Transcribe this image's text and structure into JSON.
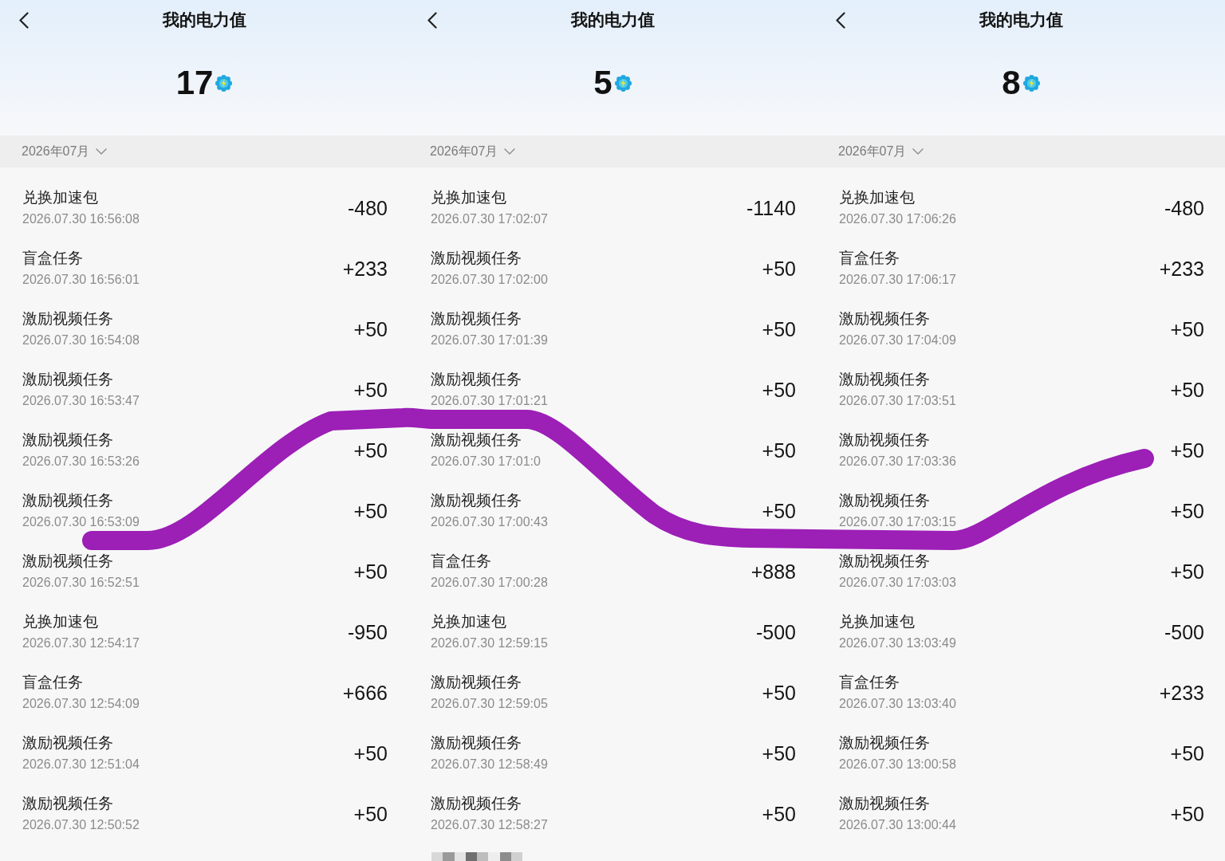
{
  "screenshots": [
    {
      "title": "我的电力值",
      "balance": "17",
      "month": "2026年07月",
      "records": [
        {
          "kind": "entry",
          "title": "兑换加速包",
          "time": "2026.07.30 16:56:08",
          "amount": "-480"
        },
        {
          "kind": "entry",
          "title": "盲盒任务",
          "time": "2026.07.30 16:56:01",
          "amount": "+233"
        },
        {
          "kind": "entry",
          "title": "激励视频任务",
          "time": "2026.07.30 16:54:08",
          "amount": "+50"
        },
        {
          "kind": "entry",
          "title": "激励视频任务",
          "time": "2026.07.30 16:53:47",
          "amount": "+50"
        },
        {
          "kind": "entry",
          "title": "激励视频任务",
          "time": "2026.07.30 16:53:26",
          "amount": "+50"
        },
        {
          "kind": "entry",
          "title": "激励视频任务",
          "time": "2026.07.30 16:53:09",
          "amount": "+50"
        },
        {
          "kind": "entry",
          "title": "激励视频任务",
          "time": "2026.07.30 16:52:51",
          "amount": "+50"
        },
        {
          "kind": "entry",
          "title": "兑换加速包",
          "time": "2026.07.30 12:54:17",
          "amount": "-950"
        },
        {
          "kind": "entry",
          "title": "盲盒任务",
          "time": "2026.07.30 12:54:09",
          "amount": "+666"
        },
        {
          "kind": "entry",
          "title": "激励视频任务",
          "time": "2026.07.30 12:51:04",
          "amount": "+50"
        },
        {
          "kind": "entry",
          "title": "激励视频任务",
          "time": "2026.07.30 12:50:52",
          "amount": "+50"
        }
      ]
    },
    {
      "title": "我的电力值",
      "balance": "5",
      "month": "2026年07月",
      "records": [
        {
          "kind": "entry",
          "title": "兑换加速包",
          "time": "2026.07.30 17:02:07",
          "amount": "-1140"
        },
        {
          "kind": "entry",
          "title": "激励视频任务",
          "time": "2026.07.30 17:02:00",
          "amount": "+50"
        },
        {
          "kind": "entry",
          "title": "激励视频任务",
          "time": "2026.07.30 17:01:39",
          "amount": "+50"
        },
        {
          "kind": "entry",
          "title": "激励视频任务",
          "time": "2026.07.30 17:01:21",
          "amount": "+50"
        },
        {
          "kind": "entry",
          "title": "激励视频任务",
          "time": "2026.07.30 17:01:0",
          "amount": "+50"
        },
        {
          "kind": "entry",
          "title": "激励视频任务",
          "time": "2026.07.30 17:00:43",
          "amount": "+50"
        },
        {
          "kind": "entry",
          "title": "盲盒任务",
          "time": "2026.07.30 17:00:28",
          "amount": "+888"
        },
        {
          "kind": "entry",
          "title": "兑换加速包",
          "time": "2026.07.30 12:59:15",
          "amount": "-500"
        },
        {
          "kind": "entry",
          "title": "激励视频任务",
          "time": "2026.07.30 12:59:05",
          "amount": "+50"
        },
        {
          "kind": "entry",
          "title": "激励视频任务",
          "time": "2026.07.30 12:58:49",
          "amount": "+50"
        },
        {
          "kind": "entry",
          "title": "激励视频任务",
          "time": "2026.07.30 12:58:27",
          "amount": "+50"
        },
        {
          "kind": "pixelated"
        }
      ]
    },
    {
      "title": "我的电力值",
      "balance": "8",
      "month": "2026年07月",
      "records": [
        {
          "kind": "entry",
          "title": "兑换加速包",
          "time": "2026.07.30 17:06:26",
          "amount": "-480"
        },
        {
          "kind": "entry",
          "title": "盲盒任务",
          "time": "2026.07.30 17:06:17",
          "amount": "+233"
        },
        {
          "kind": "entry",
          "title": "激励视频任务",
          "time": "2026.07.30 17:04:09",
          "amount": "+50"
        },
        {
          "kind": "entry",
          "title": "激励视频任务",
          "time": "2026.07.30 17:03:51",
          "amount": "+50"
        },
        {
          "kind": "entry",
          "title": "激励视频任务",
          "time": "2026.07.30 17:03:36",
          "amount": "+50"
        },
        {
          "kind": "entry",
          "title": "激励视频任务",
          "time": "2026.07.30 17:03:15",
          "amount": "+50"
        },
        {
          "kind": "entry",
          "title": "激励视频任务",
          "time": "2026.07.30 17:03:03",
          "amount": "+50"
        },
        {
          "kind": "entry",
          "title": "兑换加速包",
          "time": "2026.07.30 13:03:49",
          "amount": "-500"
        },
        {
          "kind": "entry",
          "title": "盲盒任务",
          "time": "2026.07.30 13:03:40",
          "amount": "+233"
        },
        {
          "kind": "entry",
          "title": "激励视频任务",
          "time": "2026.07.30 13:00:58",
          "amount": "+50"
        },
        {
          "kind": "entry",
          "title": "激励视频任务",
          "time": "2026.07.30 13:00:44",
          "amount": "+50"
        }
      ]
    }
  ]
}
